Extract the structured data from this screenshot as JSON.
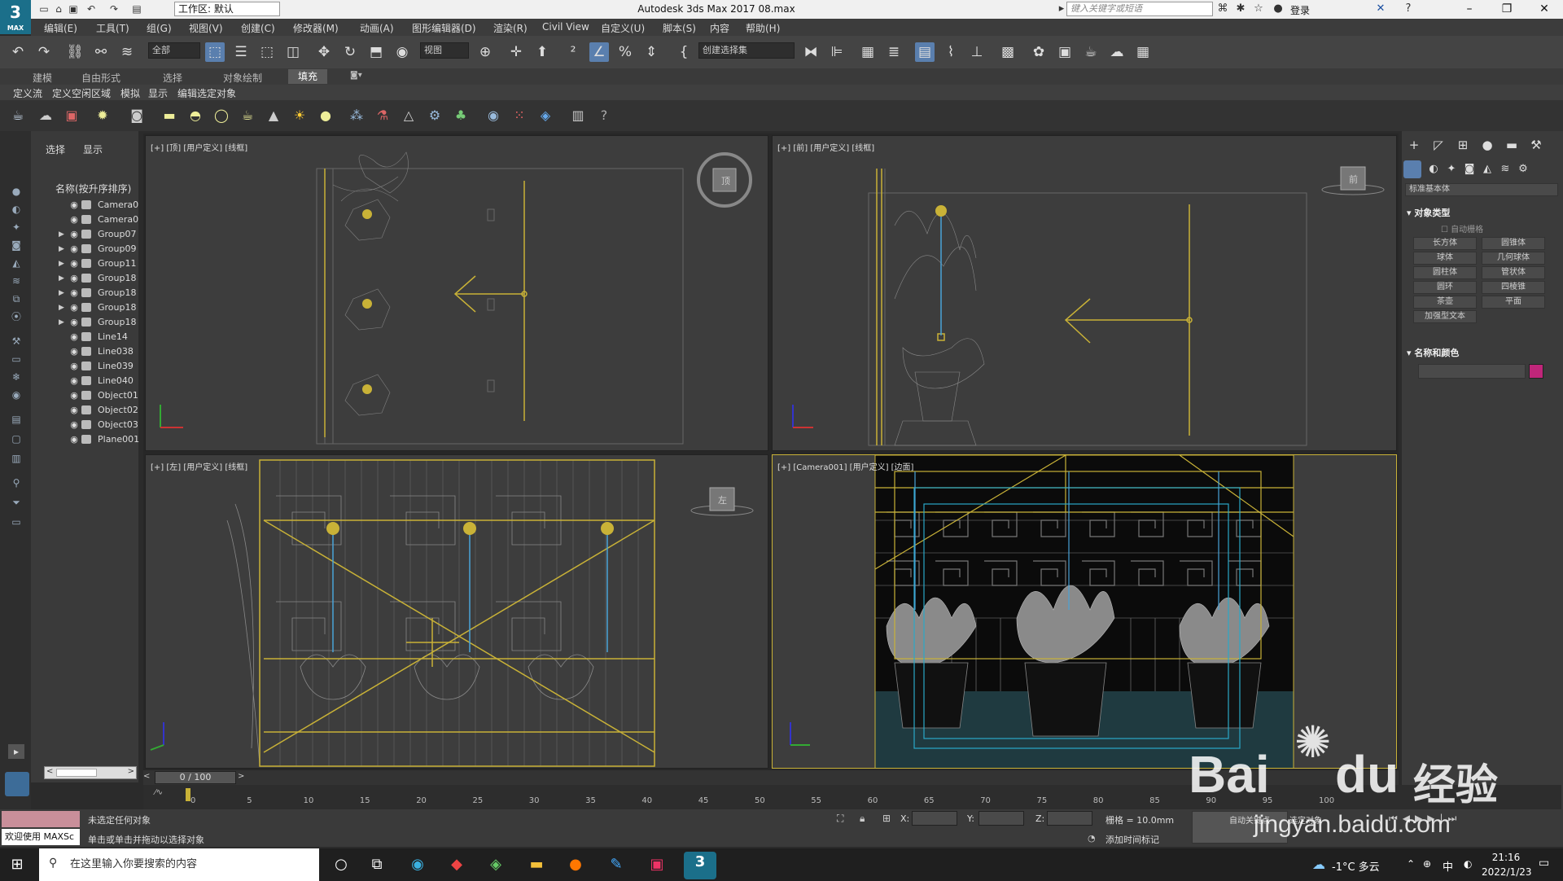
{
  "app": {
    "logo_text": "3",
    "logo_sub": "MAX",
    "workspace_label": "工作区: 默认",
    "window_title": "Autodesk 3ds Max 2017      08.max",
    "search_placeholder": "键入关键字或短语",
    "login_label": "登录"
  },
  "menus": [
    "编辑(E)",
    "工具(T)",
    "组(G)",
    "视图(V)",
    "创建(C)",
    "修改器(M)",
    "动画(A)",
    "图形编辑器(D)",
    "渲染(R)",
    "Civil View",
    "自定义(U)",
    "脚本(S)",
    "内容",
    "帮助(H)"
  ],
  "toolbar": {
    "filter_label": "全部",
    "refcoord_label": "视图",
    "selection_set_label": "创建选择集"
  },
  "ribbon": {
    "tabs": [
      "建模",
      "自由形式",
      "选择",
      "对象绘制",
      "填充"
    ],
    "active_tab": "填充",
    "sub_items": [
      "定义流",
      "定义空闲区域",
      "模拟",
      "显示",
      "编辑选定对象"
    ]
  },
  "scene_explorer": {
    "tabs": [
      "选择",
      "显示"
    ],
    "header": "名称(按升序排序)",
    "items": [
      {
        "name": "Camera0",
        "group": false
      },
      {
        "name": "Camera0",
        "group": false
      },
      {
        "name": "Group07",
        "group": true
      },
      {
        "name": "Group09",
        "group": true
      },
      {
        "name": "Group11",
        "group": true
      },
      {
        "name": "Group18",
        "group": true
      },
      {
        "name": "Group18",
        "group": true
      },
      {
        "name": "Group18",
        "group": true
      },
      {
        "name": "Group18",
        "group": true
      },
      {
        "name": "Line14",
        "group": false
      },
      {
        "name": "Line038",
        "group": false
      },
      {
        "name": "Line039",
        "group": false
      },
      {
        "name": "Line040",
        "group": false
      },
      {
        "name": "Object01",
        "group": false
      },
      {
        "name": "Object02",
        "group": false
      },
      {
        "name": "Object03",
        "group": false
      },
      {
        "name": "Plane001",
        "group": false
      }
    ]
  },
  "viewports": {
    "top": "[+] [顶] [用户定义] [线框]",
    "front": "[+] [前] [用户定义] [线框]",
    "left": "[+] [左] [用户定义] [线框]",
    "camera": "[+] [Camera001] [用户定义] [边面]",
    "viewcube_left": "左"
  },
  "command_panel": {
    "dropdown": "标准基本体",
    "section_object_type": "对象类型",
    "autogrid": "自动栅格",
    "buttons": [
      "长方体",
      "圆锥体",
      "球体",
      "几何球体",
      "圆柱体",
      "管状体",
      "圆环",
      "四棱锥",
      "茶壶",
      "平面",
      "加强型文本"
    ],
    "section_name_color": "名称和颜色",
    "color_swatch": "#c0267a"
  },
  "timeline": {
    "frame_label": "0 / 100",
    "ticks": [
      "0",
      "5",
      "10",
      "15",
      "20",
      "25",
      "30",
      "35",
      "40",
      "45",
      "50",
      "55",
      "60",
      "65",
      "70",
      "75",
      "80",
      "85",
      "90",
      "95",
      "100"
    ]
  },
  "status": {
    "welcome": "欢迎使用 MAXSc",
    "msg1": "未选定任何对象",
    "msg2": "单击或单击并拖动以选择对象",
    "x_label": "X:",
    "y_label": "Y:",
    "z_label": "Z:",
    "grid": "栅格 = 10.0mm",
    "add_time_tag": "添加时间标记",
    "auto_key": "自动关键点",
    "selected_obj": "选定对象"
  },
  "taskbar": {
    "search_placeholder": "在这里输入你要搜索的内容",
    "weather": "-1°C 多云",
    "ime": "中",
    "time": "21:16",
    "date": "2022/1/23"
  },
  "watermark": {
    "brand": "Bai",
    "brand2": "du",
    "cn": "经验",
    "url": "jingyan.baidu.com"
  }
}
